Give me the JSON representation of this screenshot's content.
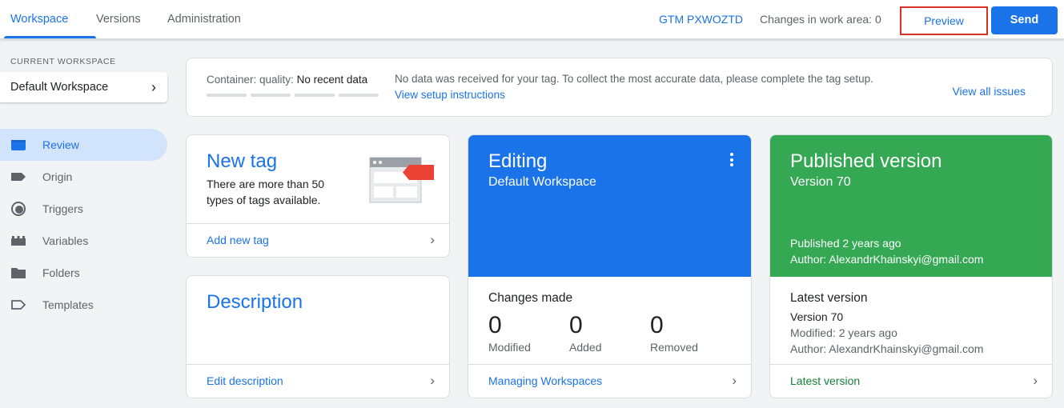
{
  "topbar": {
    "tabs": [
      "Workspace",
      "Versions",
      "Administration"
    ],
    "container_id": "GTM PXWOZTD",
    "changes_label": "Changes in work area: 0",
    "preview_label": "Preview",
    "send_label": "Send"
  },
  "sidebar": {
    "section_label": "CURRENT WORKSPACE",
    "workspace_name": "Default Workspace",
    "items": [
      {
        "label": "Review",
        "icon": "review-icon"
      },
      {
        "label": "Origin",
        "icon": "tag-icon"
      },
      {
        "label": "Triggers",
        "icon": "trigger-icon"
      },
      {
        "label": "Variables",
        "icon": "variables-icon"
      },
      {
        "label": "Folders",
        "icon": "folder-icon"
      },
      {
        "label": "Templates",
        "icon": "template-icon"
      }
    ]
  },
  "quality": {
    "label": "Container: quality:",
    "value": "No recent data",
    "message": "No data was received for your tag. To collect the most accurate data, please complete the tag setup.",
    "setup_link": "View setup instructions",
    "issues_link": "View all issues"
  },
  "new_tag": {
    "title": "New tag",
    "description": "There are more than 50 types of tags available.",
    "link": "Add new tag"
  },
  "description_card": {
    "title": "Description",
    "link": "Edit description"
  },
  "editing": {
    "title": "Editing",
    "workspace": "Default Workspace",
    "changes_title": "Changes made",
    "stats": [
      {
        "value": "0",
        "label": "Modified"
      },
      {
        "value": "0",
        "label": "Added"
      },
      {
        "value": "0",
        "label": "Removed"
      }
    ],
    "link": "Managing Workspaces"
  },
  "published": {
    "title": "Published version",
    "version": "Version 70",
    "published_when": "Published 2 years ago",
    "author": "Author: AlexandrKhainskyi@gmail.com",
    "latest_title": "Latest version",
    "latest_version": "Version 70",
    "modified": "Modified: 2 years ago",
    "latest_author": "Author: AlexandrKhainskyi@gmail.com",
    "link": "Latest version"
  },
  "colors": {
    "accent": "#1a73e8",
    "published": "#34a853",
    "highlight": "#d93025"
  }
}
